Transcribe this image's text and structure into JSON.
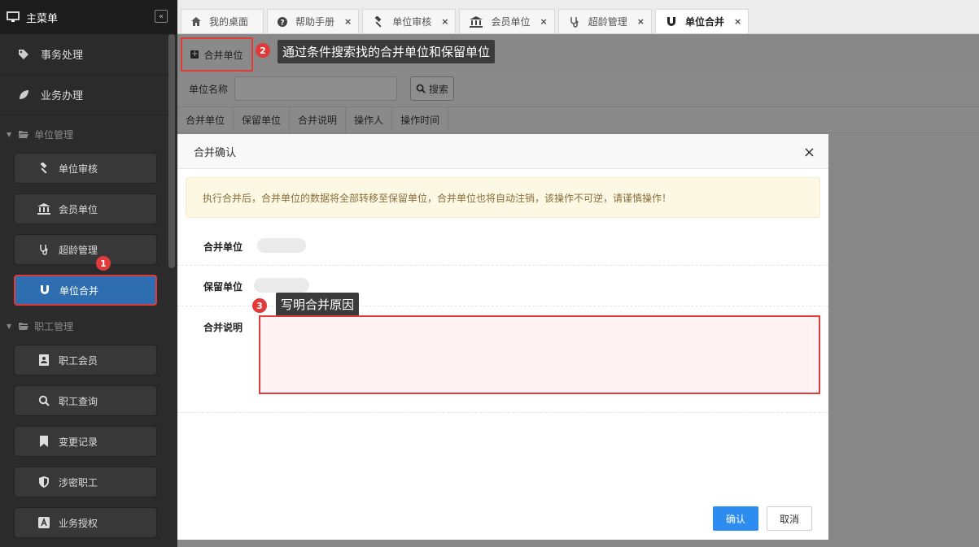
{
  "sidebar": {
    "title": "主菜单",
    "collapse_label": "«",
    "top_items": [
      {
        "label": "事务处理",
        "icon": "tag-icon"
      },
      {
        "label": "业务办理",
        "icon": "leaf-icon"
      }
    ],
    "groups": [
      {
        "label": "单位管理",
        "items": [
          {
            "label": "单位审核",
            "icon": "gavel-icon"
          },
          {
            "label": "会员单位",
            "icon": "bank-icon"
          },
          {
            "label": "超龄管理",
            "icon": "stethoscope-icon"
          },
          {
            "label": "单位合并",
            "icon": "magnet-icon"
          }
        ]
      },
      {
        "label": "职工管理",
        "items": [
          {
            "label": "职工会员",
            "icon": "contact-book-icon"
          },
          {
            "label": "职工查询",
            "icon": "search-icon"
          },
          {
            "label": "变更记录",
            "icon": "bookmark-icon"
          },
          {
            "label": "涉密职工",
            "icon": "shield-icon"
          },
          {
            "label": "业务授权",
            "icon": "letter-a-icon"
          }
        ]
      }
    ]
  },
  "tabs": [
    {
      "label": "我的桌面",
      "icon": "home-icon",
      "closable": false
    },
    {
      "label": "帮助手册",
      "icon": "question-icon",
      "closable": true
    },
    {
      "label": "单位审核",
      "icon": "gavel-icon",
      "closable": true
    },
    {
      "label": "会员单位",
      "icon": "bank-icon",
      "closable": true
    },
    {
      "label": "超龄管理",
      "icon": "stethoscope-icon",
      "closable": true
    },
    {
      "label": "单位合并",
      "icon": "magnet-icon",
      "closable": true,
      "active": true
    }
  ],
  "toolbar": {
    "merge_button": "合并单位"
  },
  "search": {
    "label": "单位名称",
    "button": "搜索"
  },
  "table": {
    "headers": [
      "合并单位",
      "保留单位",
      "合并说明",
      "操作人",
      "操作时间"
    ]
  },
  "annotations": [
    {
      "num": "1"
    },
    {
      "num": "2",
      "text": "通过条件搜索找的合并单位和保留单位"
    },
    {
      "num": "3",
      "text": "写明合并原因"
    }
  ],
  "modal": {
    "title": "合并确认",
    "close": "×",
    "alert": "执行合并后，合并单位的数据将全部转移至保留单位，合并单位也将自动注销，该操作不可逆，请谨慎操作！",
    "merge_unit_label": "合并单位",
    "keep_unit_label": "保留单位",
    "reason_label": "合并说明",
    "confirm": "确认",
    "cancel": "取消"
  },
  "colors": {
    "accent": "#2d8cf0",
    "highlight": "#e03b3b",
    "sidebar_active": "#2d6db0"
  }
}
